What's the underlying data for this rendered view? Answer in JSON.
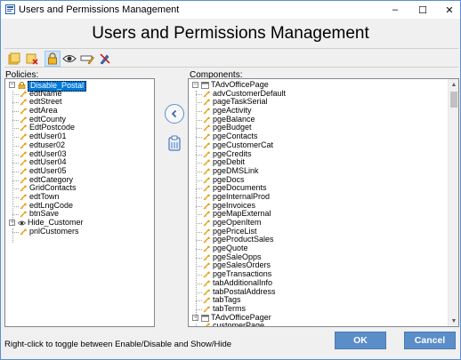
{
  "window": {
    "title": "Users and Permissions Management",
    "controls": [
      "–",
      "☐",
      "✕"
    ]
  },
  "heading": "Users and Permissions Management",
  "toolbar": {
    "buttons": [
      "add-policy-icon",
      "delete-policy-icon",
      "lock-icon",
      "eye-icon",
      "edit-icon",
      "pen-disable-icon"
    ]
  },
  "policies": {
    "label": "Policies:",
    "tree": [
      {
        "label": "Disable_Postal",
        "depth": 0,
        "expanded": true,
        "selected": true,
        "icon": "lock"
      },
      {
        "label": "edtName",
        "depth": 1,
        "icon": "key"
      },
      {
        "label": "edtStreet",
        "depth": 1,
        "icon": "key"
      },
      {
        "label": "edtArea",
        "depth": 1,
        "icon": "key"
      },
      {
        "label": "edtCounty",
        "depth": 1,
        "icon": "key"
      },
      {
        "label": "EdtPostcode",
        "depth": 1,
        "icon": "key"
      },
      {
        "label": "edtUser01",
        "depth": 1,
        "icon": "key"
      },
      {
        "label": "edtuser02",
        "depth": 1,
        "icon": "key"
      },
      {
        "label": "edtUser03",
        "depth": 1,
        "icon": "key"
      },
      {
        "label": "edtUser04",
        "depth": 1,
        "icon": "key"
      },
      {
        "label": "edtUser05",
        "depth": 1,
        "icon": "key"
      },
      {
        "label": "edtCategory",
        "depth": 1,
        "icon": "key"
      },
      {
        "label": "GridContacts",
        "depth": 1,
        "icon": "key"
      },
      {
        "label": "edtTown",
        "depth": 1,
        "icon": "key"
      },
      {
        "label": "edtLngCode",
        "depth": 1,
        "icon": "key"
      },
      {
        "label": "btnSave",
        "depth": 1,
        "icon": "key"
      },
      {
        "label": "Hide_Customer",
        "depth": 0,
        "expanded": true,
        "icon": "eye"
      },
      {
        "label": "pnlCustomers",
        "depth": 1,
        "icon": "key"
      }
    ]
  },
  "components": {
    "label": "Components:",
    "tree": [
      {
        "label": "TAdvOfficePage",
        "depth": 0,
        "expanded": true,
        "icon": "form"
      },
      {
        "label": "advCustomerDefault",
        "depth": 1,
        "icon": "key"
      },
      {
        "label": "pageTaskSerial",
        "depth": 1,
        "icon": "key"
      },
      {
        "label": "pgeActivity",
        "depth": 1,
        "icon": "key"
      },
      {
        "label": "pgeBalance",
        "depth": 1,
        "icon": "key"
      },
      {
        "label": "pgeBudget",
        "depth": 1,
        "icon": "key"
      },
      {
        "label": "pgeContacts",
        "depth": 1,
        "icon": "key"
      },
      {
        "label": "pgeCustomerCat",
        "depth": 1,
        "icon": "key"
      },
      {
        "label": "pgeCredits",
        "depth": 1,
        "icon": "key"
      },
      {
        "label": "pgeDebit",
        "depth": 1,
        "icon": "key"
      },
      {
        "label": "pgeDMSLink",
        "depth": 1,
        "icon": "key"
      },
      {
        "label": "pgeDocs",
        "depth": 1,
        "icon": "key"
      },
      {
        "label": "pgeDocuments",
        "depth": 1,
        "icon": "key"
      },
      {
        "label": "pgeInternalProd",
        "depth": 1,
        "icon": "key"
      },
      {
        "label": "pgeInvoices",
        "depth": 1,
        "icon": "key"
      },
      {
        "label": "pgeMapExternal",
        "depth": 1,
        "icon": "key"
      },
      {
        "label": "pgeOpenItem",
        "depth": 1,
        "icon": "key"
      },
      {
        "label": "pgePriceList",
        "depth": 1,
        "icon": "key"
      },
      {
        "label": "pgeProductSales",
        "depth": 1,
        "icon": "key"
      },
      {
        "label": "pgeQuote",
        "depth": 1,
        "icon": "key"
      },
      {
        "label": "pgeSaleOpps",
        "depth": 1,
        "icon": "key"
      },
      {
        "label": "pgeSalesOrders",
        "depth": 1,
        "icon": "key"
      },
      {
        "label": "pgeTransactions",
        "depth": 1,
        "icon": "key"
      },
      {
        "label": "tabAdditionalInfo",
        "depth": 1,
        "icon": "key"
      },
      {
        "label": "tabPostalAddress",
        "depth": 1,
        "icon": "key"
      },
      {
        "label": "tabTags",
        "depth": 1,
        "icon": "key"
      },
      {
        "label": "tabTerms",
        "depth": 1,
        "icon": "key"
      },
      {
        "label": "TAdvOfficePager",
        "depth": 0,
        "expanded": true,
        "icon": "form"
      },
      {
        "label": "customerPage",
        "depth": 1,
        "icon": "key"
      }
    ]
  },
  "actions": {
    "move_left_icon": "arrow-left-circle-icon",
    "clipboard_icon": "clipboard-icon"
  },
  "status": {
    "hint": "Right-click to toggle between Enable/Disable and Show/Hide"
  },
  "buttons": {
    "ok": "OK",
    "cancel": "Cancel"
  },
  "colors": {
    "accent": "#5b8dc9",
    "selection": "#0078d7",
    "key_icon": "#e8a317"
  }
}
